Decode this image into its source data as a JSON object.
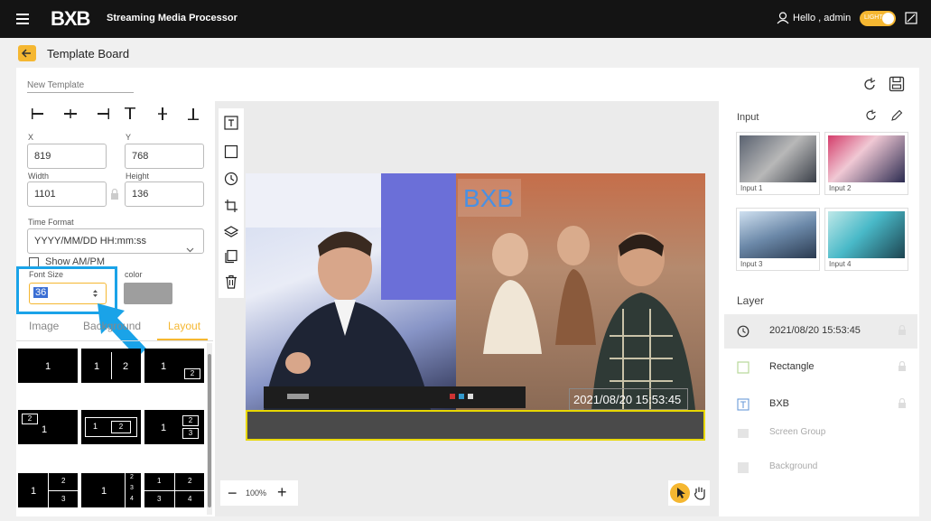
{
  "app": {
    "title": "Streaming Media Processor",
    "greeting": "Hello , admin",
    "theme_toggle_label": "LIGHT"
  },
  "page": {
    "title": "Template Board",
    "template_name_placeholder": "New Template"
  },
  "properties": {
    "x_label": "X",
    "x_value": "819",
    "y_label": "Y",
    "y_value": "768",
    "width_label": "Width",
    "width_value": "1101",
    "height_label": "Height",
    "height_value": "136",
    "time_format_label": "Time Format",
    "time_format_value": "YYYY/MM/DD HH:mm:ss",
    "show_ampm_label": "Show AM/PM",
    "font_size_label": "Font Size",
    "font_size_value": "36",
    "color_label": "color",
    "color_value": "#9e9e9e"
  },
  "tabs": [
    {
      "label": "Image"
    },
    {
      "label": "Background"
    },
    {
      "label": "Layout",
      "active": true
    }
  ],
  "layouts": [
    {
      "cells": [
        "1"
      ]
    },
    {
      "cells": [
        "1",
        "2"
      ]
    },
    {
      "cells": [
        "1",
        "2"
      ]
    },
    {
      "cells": [
        "2",
        "1"
      ]
    },
    {
      "cells": [
        "1",
        "2"
      ]
    },
    {
      "cells": [
        "1",
        "2",
        "3"
      ]
    },
    {
      "cells": [
        "1",
        "2",
        "3"
      ]
    },
    {
      "cells": [
        "1",
        "2",
        "3",
        "4"
      ]
    },
    {
      "cells": [
        "1",
        "2",
        "3",
        "4"
      ]
    }
  ],
  "canvas": {
    "overlay_text": "BXB",
    "timestamp": "2021/08/20 15:53:45",
    "zoom": "100%"
  },
  "inputs": {
    "title": "Input",
    "items": [
      {
        "label": "Input 1"
      },
      {
        "label": "Input 2"
      },
      {
        "label": "Input 3"
      },
      {
        "label": "Input 4"
      }
    ]
  },
  "layers": {
    "title": "Layer",
    "items": [
      {
        "label": "2021/08/20 15:53:45",
        "icon": "clock-icon"
      },
      {
        "label": "Rectangle",
        "icon": "rectangle-icon"
      },
      {
        "label": "BXB",
        "icon": "text-icon"
      },
      {
        "label": "Screen Group",
        "icon": "screen-group-icon"
      },
      {
        "label": "Background",
        "icon": "background-icon"
      }
    ]
  },
  "colors": {
    "accent": "#f5b731",
    "highlight": "#1aa3e8",
    "topbar": "#141414",
    "selection": "#e8d700"
  }
}
